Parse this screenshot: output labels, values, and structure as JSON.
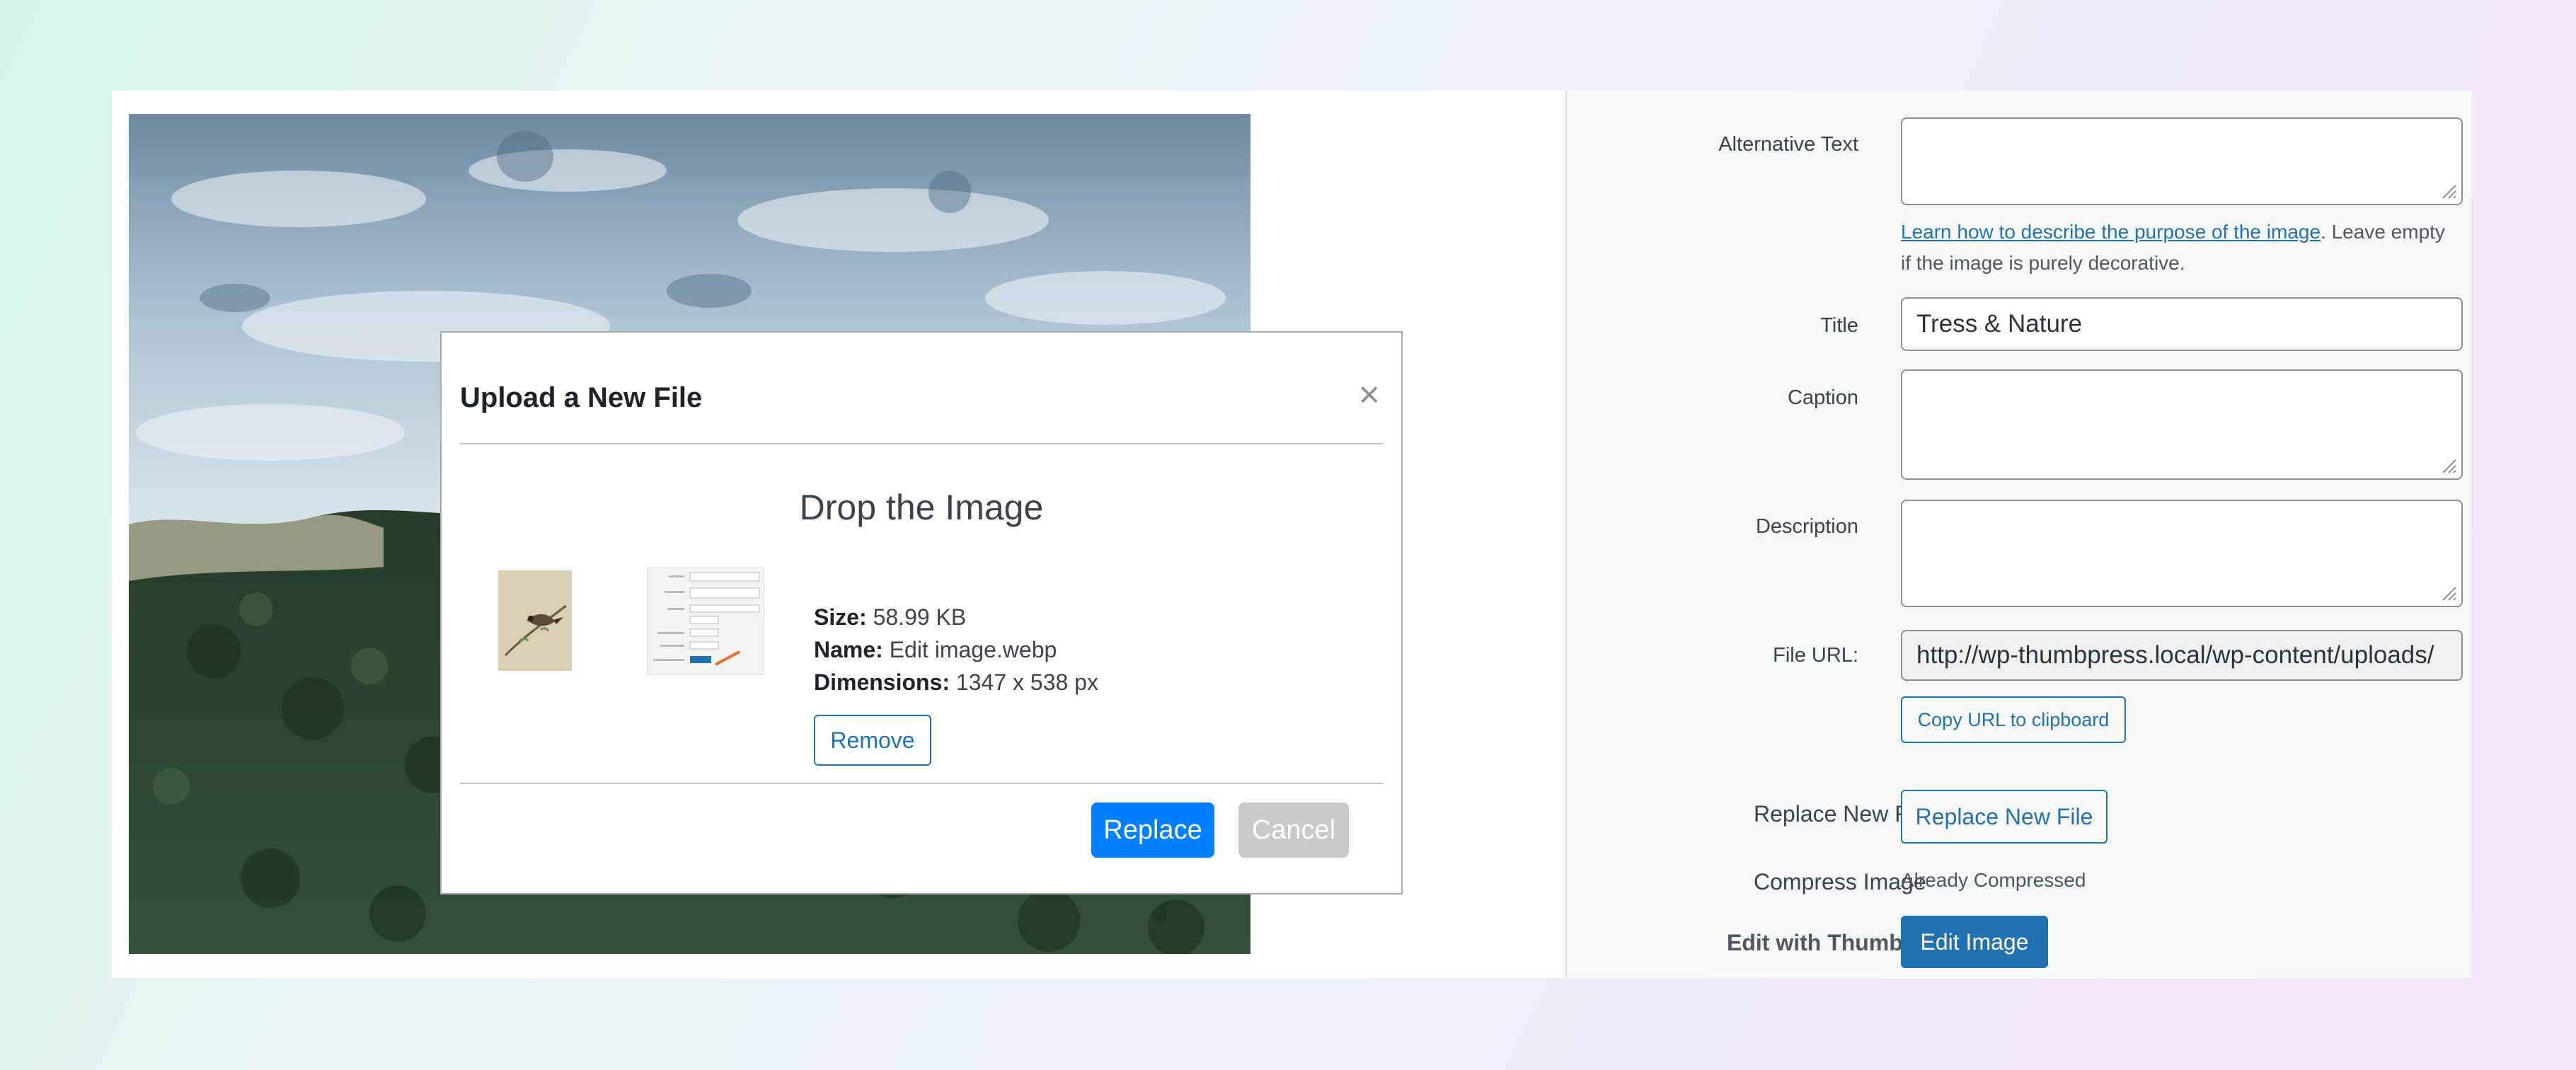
{
  "modal": {
    "title": "Upload a New File",
    "close_glyph": "×",
    "drop_text": "Drop the Image",
    "size_label": "Size:",
    "size_value": "58.99 KB",
    "name_label": "Name:",
    "name_value": "Edit image.webp",
    "dimensions_label": "Dimensions:",
    "dimensions_value": "1347 x 538 px",
    "remove_label": "Remove",
    "replace_label": "Replace",
    "cancel_label": "Cancel"
  },
  "attachment": {
    "alt_text_label": "Alternative Text",
    "alt_text_value": "",
    "help_link": "Learn how to describe the purpose of the image",
    "help_rest_1": ". Leave empty",
    "help_rest_2": "if the image is purely decorative.",
    "title_label": "Title",
    "title_value": "Tress & Nature",
    "caption_label": "Caption",
    "caption_value": "",
    "description_label": "Description",
    "description_value": "",
    "file_url_label": "File URL:",
    "file_url_value": "http://wp-thumbpress.local/wp-content/uploads/",
    "copy_button": "Copy URL to clipboard",
    "replace_label": "Replace New File",
    "replace_button": "Replace New File",
    "compress_label": "Compress Image",
    "compress_status": "Already Compressed",
    "edit_label": "Edit with ThumbPress",
    "edit_button": "Edit Image"
  },
  "colors": {
    "wp_blue": "#2271b1",
    "replace_blue": "#0080ff",
    "cancel_gray": "#c9c9c9"
  }
}
